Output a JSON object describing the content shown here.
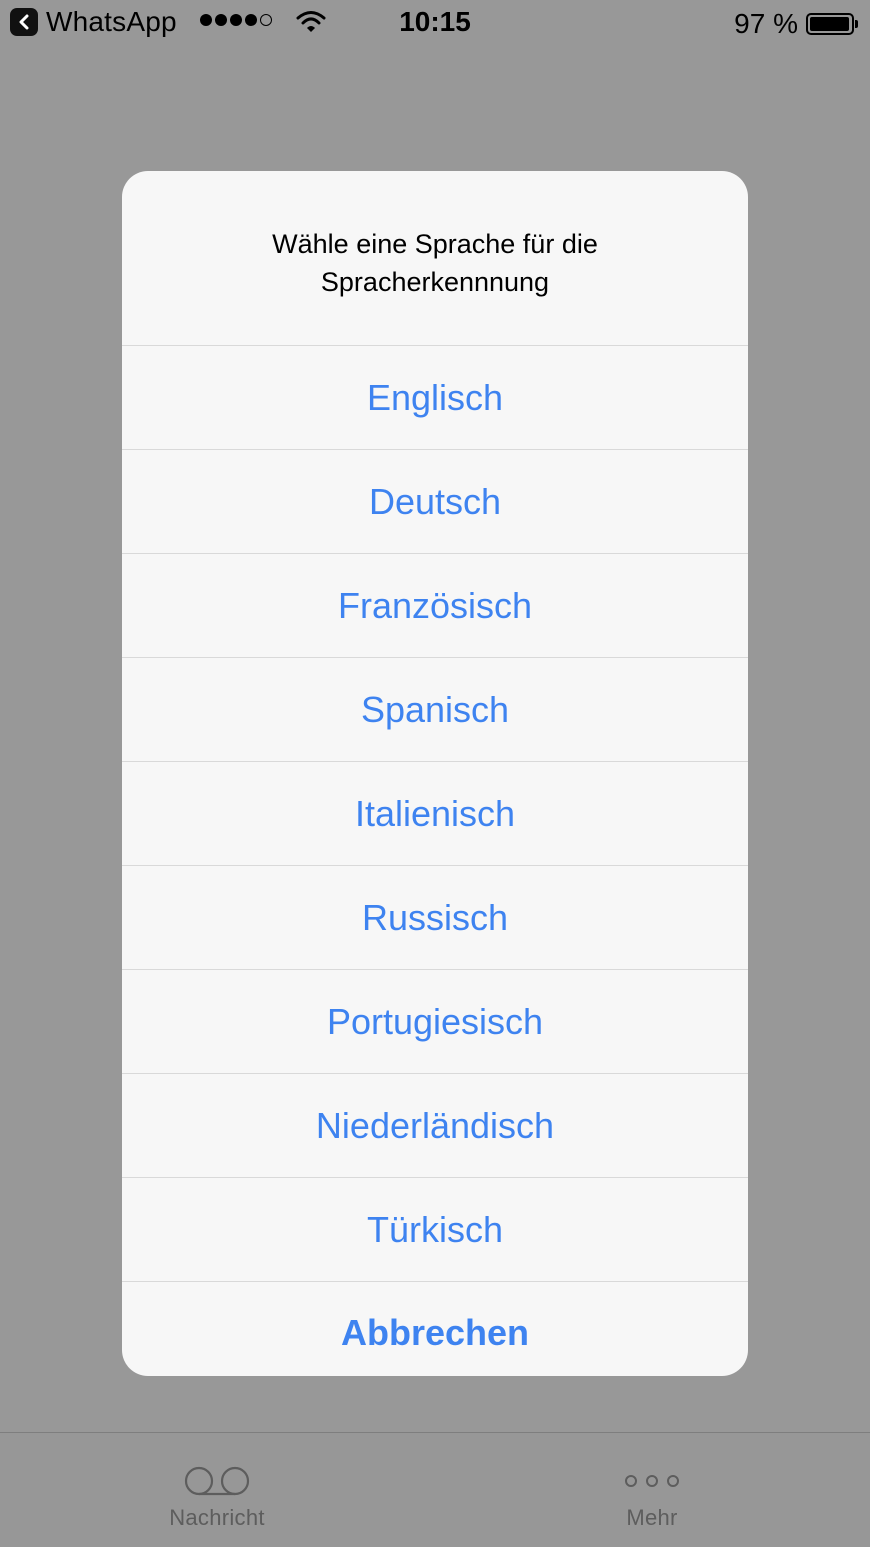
{
  "status_bar": {
    "back_app": "WhatsApp",
    "time": "10:15",
    "battery": "97 %",
    "battery_level": 0.97,
    "signal_bars_filled": 4,
    "signal_bars_total": 5
  },
  "alert": {
    "title": "Wähle eine Sprache für die Spracherkennnung",
    "options": [
      "Englisch",
      "Deutsch",
      "Französisch",
      "Spanisch",
      "Italienisch",
      "Russisch",
      "Portugiesisch",
      "Niederländisch",
      "Türkisch"
    ],
    "cancel": "Abbrechen"
  },
  "tab_bar": {
    "voicemail_label": "Nachricht",
    "more_label": "Mehr"
  },
  "icons": {
    "back": "chevron-left-icon",
    "wifi": "wifi-icon",
    "battery": "battery-icon",
    "voicemail": "voicemail-icon",
    "more": "more-dots-icon"
  },
  "colors": {
    "accent": "#3e83f0",
    "dim_background": "#989898",
    "alert_background": "#f7f7f7"
  }
}
